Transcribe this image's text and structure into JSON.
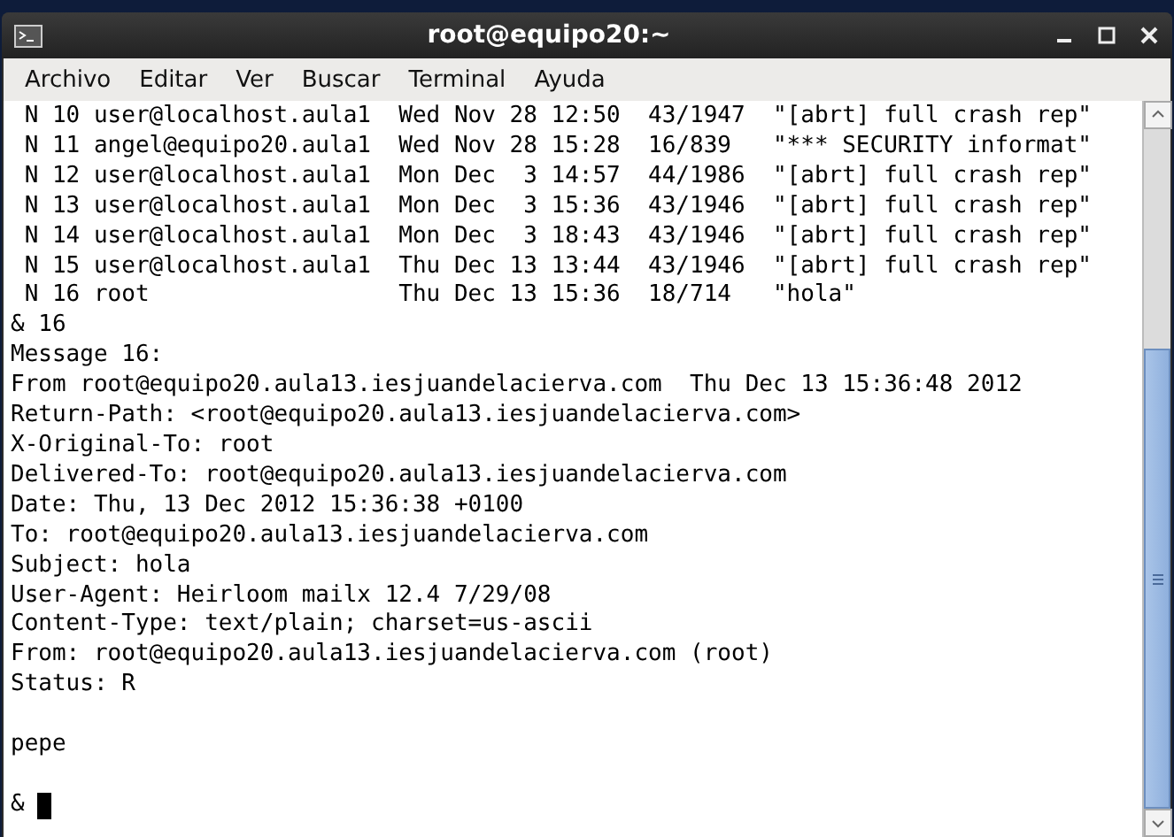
{
  "window": {
    "title": "root@equipo20:~"
  },
  "menu": [
    "Archivo",
    "Editar",
    "Ver",
    "Buscar",
    "Terminal",
    "Ayuda"
  ],
  "terminal": {
    "lines": [
      {
        "kind": "text",
        "text": " N 10 user@localhost.aula1  Wed Nov 28 12:50  43/1947  \"[abrt] full crash rep\""
      },
      {
        "kind": "text",
        "text": " N 11 angel@equipo20.aula1  Wed Nov 28 15:28  16/839   \"*** SECURITY informat\""
      },
      {
        "kind": "text",
        "text": " N 12 user@localhost.aula1  Mon Dec  3 14:57  44/1986  \"[abrt] full crash rep\""
      },
      {
        "kind": "text",
        "text": " N 13 user@localhost.aula1  Mon Dec  3 15:36  43/1946  \"[abrt] full crash rep\""
      },
      {
        "kind": "text",
        "text": " N 14 user@localhost.aula1  Mon Dec  3 18:43  43/1946  \"[abrt] full crash rep\""
      },
      {
        "kind": "text",
        "text": " N 15 user@localhost.aula1  Thu Dec 13 13:44  43/1946  \"[abrt] full crash rep\""
      },
      {
        "kind": "text",
        "text": " N 16 root                  Thu Dec 13 15:36  18/714   \"hola\""
      },
      {
        "kind": "text",
        "text": "& 16"
      },
      {
        "kind": "text",
        "text": "Message 16:"
      },
      {
        "kind": "text",
        "text": "From root@equipo20.aula13.iesjuandelacierva.com  Thu Dec 13 15:36:48 2012"
      },
      {
        "kind": "text",
        "text": "Return-Path: <root@equipo20.aula13.iesjuandelacierva.com>"
      },
      {
        "kind": "text",
        "text": "X-Original-To: root"
      },
      {
        "kind": "text",
        "text": "Delivered-To: root@equipo20.aula13.iesjuandelacierva.com"
      },
      {
        "kind": "text",
        "text": "Date: Thu, 13 Dec 2012 15:36:38 +0100"
      },
      {
        "kind": "text",
        "text": "To: root@equipo20.aula13.iesjuandelacierva.com"
      },
      {
        "kind": "text",
        "text": "Subject: hola"
      },
      {
        "kind": "text",
        "text": "User-Agent: Heirloom mailx 12.4 7/29/08"
      },
      {
        "kind": "text",
        "text": "Content-Type: text/plain; charset=us-ascii"
      },
      {
        "kind": "text",
        "text": "From: root@equipo20.aula13.iesjuandelacierva.com (root)"
      },
      {
        "kind": "text",
        "text": "Status: R"
      },
      {
        "kind": "blank"
      },
      {
        "kind": "text",
        "text": "pepe"
      },
      {
        "kind": "blank"
      },
      {
        "kind": "prompt",
        "text": "&"
      }
    ]
  }
}
